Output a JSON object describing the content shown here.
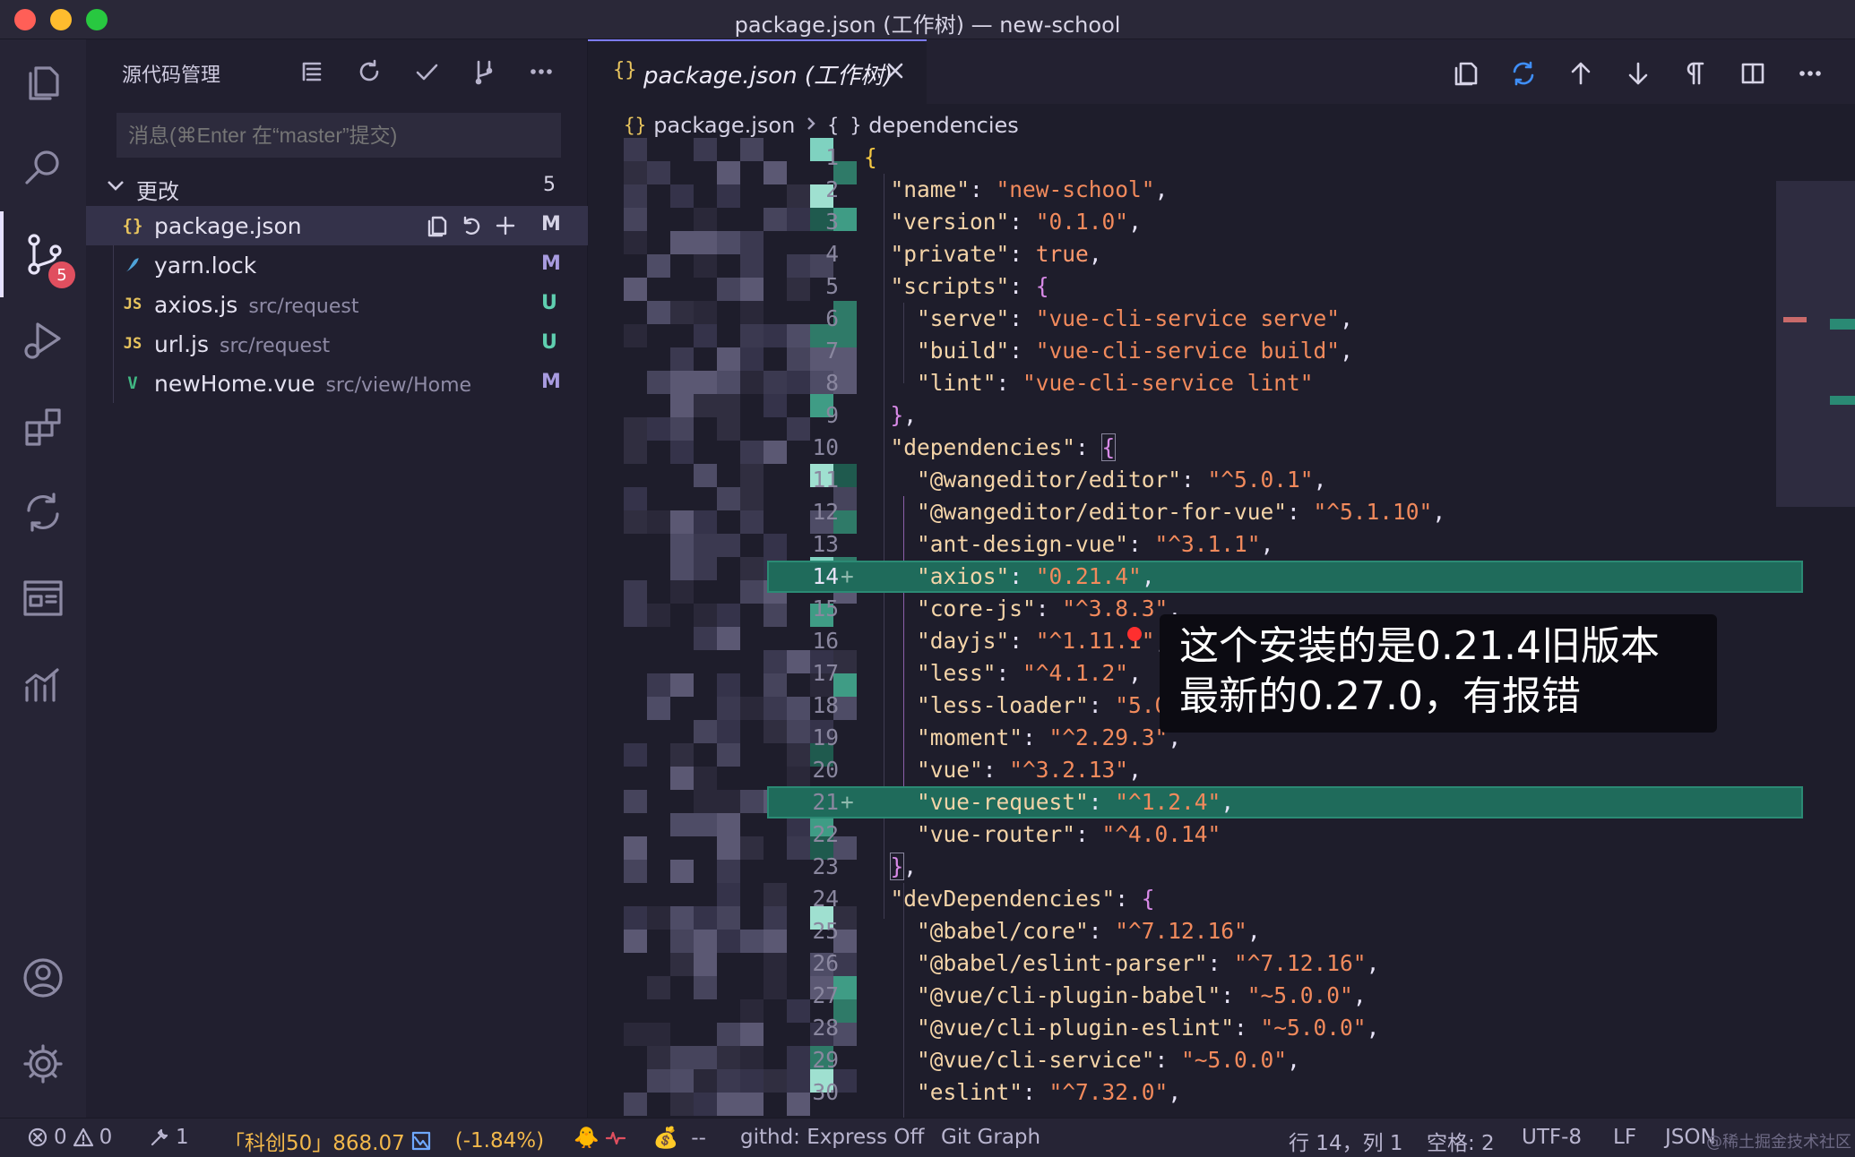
{
  "window": {
    "title": "package.json (工作树) — new-school"
  },
  "activity_bar": {
    "items": [
      {
        "name": "explorer-icon"
      },
      {
        "name": "search-icon"
      },
      {
        "name": "source-control-icon",
        "badge": "5"
      },
      {
        "name": "run-debug-icon"
      },
      {
        "name": "extensions-icon"
      },
      {
        "name": "diff-icon"
      },
      {
        "name": "browser-preview-icon"
      },
      {
        "name": "analytics-icon"
      },
      {
        "name": "account-icon"
      },
      {
        "name": "settings-gear-icon"
      }
    ]
  },
  "sidebar": {
    "title": "源代码管理",
    "commit_placeholder": "消息(⌘Enter 在“master”提交)",
    "changes_label": "更改",
    "changes_count": "5",
    "files": [
      {
        "icon": "{}",
        "icon_color": "#e8c45e",
        "name": "package.json",
        "path": "",
        "status": "M",
        "status_color": "#a89be0"
      },
      {
        "icon": "🧶",
        "icon_color": "#4fa3d8",
        "name": "yarn.lock",
        "path": "",
        "status": "M",
        "status_color": "#a89be0"
      },
      {
        "icon": "JS",
        "icon_color": "#e8c45e",
        "name": "axios.js",
        "path": "src/request",
        "status": "U",
        "status_color": "#5fcfb0"
      },
      {
        "icon": "JS",
        "icon_color": "#e8c45e",
        "name": "url.js",
        "path": "src/request",
        "status": "U",
        "status_color": "#5fcfb0"
      },
      {
        "icon": "V",
        "icon_color": "#41b883",
        "name": "newHome.vue",
        "path": "src/view/Home",
        "status": "M",
        "status_color": "#a89be0"
      }
    ]
  },
  "editor": {
    "tab": {
      "icon": "{}",
      "title": "package.json (工作树)"
    },
    "breadcrumb": {
      "file": "package.json",
      "symbol": "dependencies"
    },
    "lines": [
      {
        "n": "1",
        "m": ""
      },
      {
        "n": "2",
        "m": ""
      },
      {
        "n": "3",
        "m": ""
      },
      {
        "n": "4",
        "m": ""
      },
      {
        "n": "5",
        "m": ""
      },
      {
        "n": "6",
        "m": ""
      },
      {
        "n": "7",
        "m": ""
      },
      {
        "n": "8",
        "m": ""
      },
      {
        "n": "9",
        "m": ""
      },
      {
        "n": "10",
        "m": ""
      },
      {
        "n": "11",
        "m": ""
      },
      {
        "n": "12",
        "m": ""
      },
      {
        "n": "13",
        "m": ""
      },
      {
        "n": "14",
        "m": "+"
      },
      {
        "n": "15",
        "m": ""
      },
      {
        "n": "16",
        "m": ""
      },
      {
        "n": "17",
        "m": ""
      },
      {
        "n": "18",
        "m": ""
      },
      {
        "n": "19",
        "m": ""
      },
      {
        "n": "20",
        "m": ""
      },
      {
        "n": "21",
        "m": "+"
      },
      {
        "n": "22",
        "m": ""
      },
      {
        "n": "23",
        "m": ""
      },
      {
        "n": "24",
        "m": ""
      },
      {
        "n": "25",
        "m": ""
      },
      {
        "n": "26",
        "m": ""
      },
      {
        "n": "27",
        "m": ""
      },
      {
        "n": "28",
        "m": ""
      },
      {
        "n": "29",
        "m": ""
      },
      {
        "n": "30",
        "m": ""
      }
    ],
    "code": {
      "l2k": "\"name\"",
      "l2v": "\"new-school\"",
      "l3k": "\"version\"",
      "l3v": "\"0.1.0\"",
      "l4k": "\"private\"",
      "l4v": "true",
      "l5k": "\"scripts\"",
      "l6k": "\"serve\"",
      "l6v": "\"vue-cli-service serve\"",
      "l7k": "\"build\"",
      "l7v": "\"vue-cli-service build\"",
      "l8k": "\"lint\"",
      "l8v": "\"vue-cli-service lint\"",
      "l10k": "\"dependencies\"",
      "l11k": "\"@wangeditor/editor\"",
      "l11v": "\"^5.0.1\"",
      "l12k": "\"@wangeditor/editor-for-vue\"",
      "l12v": "\"^5.1.10\"",
      "l13k": "\"ant-design-vue\"",
      "l13v": "\"^3.1.1\"",
      "l14k": "\"axios\"",
      "l14v": "\"0.21.4\"",
      "l15k": "\"core-js\"",
      "l15v": "\"^3.8.3\"",
      "l16k": "\"dayjs\"",
      "l16v": "\"^1.11.1\"",
      "l17k": "\"less\"",
      "l17v": "\"^4.1.2\"",
      "l18k": "\"less-loader\"",
      "l18v": "\"5.0.",
      "l19k": "\"moment\"",
      "l19v": "\"^2.29.3\"",
      "l20k": "\"vue\"",
      "l20v": "\"^3.2.13\"",
      "l21k": "\"vue-request\"",
      "l21v": "\"^1.2.4\"",
      "l22k": "\"vue-router\"",
      "l22v": "\"^4.0.14\"",
      "l24k": "\"devDependencies\"",
      "l25k": "\"@babel/core\"",
      "l25v": "\"^7.12.16\"",
      "l26k": "\"@babel/eslint-parser\"",
      "l26v": "\"^7.12.16\"",
      "l27k": "\"@vue/cli-plugin-babel\"",
      "l27v": "\"~5.0.0\"",
      "l28k": "\"@vue/cli-plugin-eslint\"",
      "l28v": "\"~5.0.0\"",
      "l29k": "\"@vue/cli-service\"",
      "l29v": "\"~5.0.0\"",
      "l30k": "\"eslint\"",
      "l30v": "\"^7.32.0\""
    },
    "caption": {
      "line1": "这个安装的是0.21.4旧版本",
      "line2": "最新的0.27.0，有报错"
    }
  },
  "statusbar": {
    "errors": "0",
    "warnings": "0",
    "tools_count": "1",
    "stock_name": "「科创50」868.07",
    "stock_change": "(-1.84%)",
    "dash": "--",
    "githd": "githd: Express Off",
    "gitgraph": "Git Graph",
    "position": "行 14，列 1",
    "spaces": "空格: 2",
    "encoding": "UTF-8",
    "eol": "LF",
    "language": "JSON",
    "watermark": "@稀土掘金技术社区"
  }
}
